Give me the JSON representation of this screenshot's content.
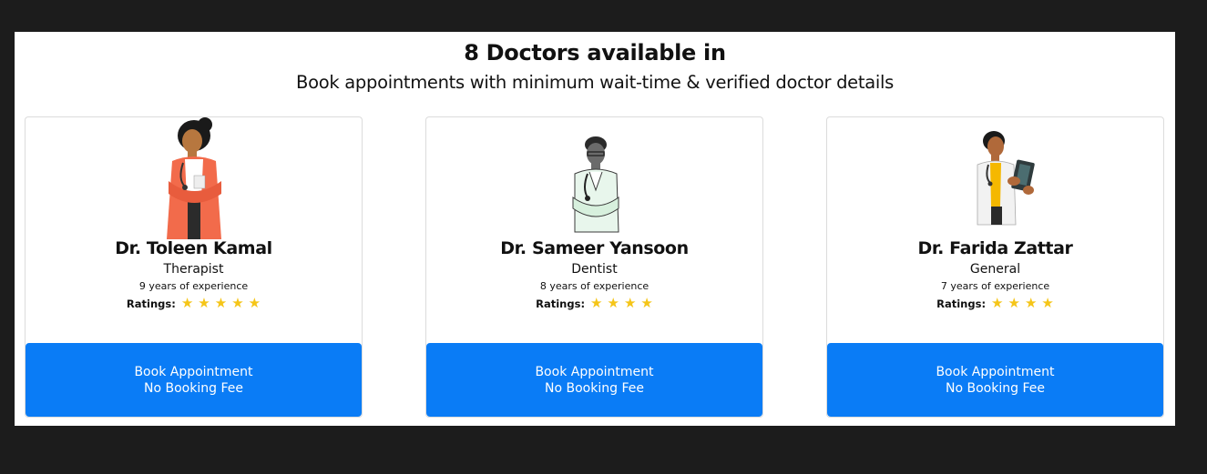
{
  "header": {
    "title": "8 Doctors  available in",
    "subtitle": "Book appointments with minimum wait-time & verified doctor details"
  },
  "doctors": [
    {
      "name": "Dr. Toleen Kamal",
      "specialty": "Therapist",
      "experience": "9 years of experience",
      "ratings_label": "Ratings:",
      "stars": 5,
      "button_line1": "Book Appointment",
      "button_line2": "No Booking Fee",
      "avatar_icon": "doctor-woman-orange-cardigan-icon"
    },
    {
      "name": "Dr. Sameer Yansoon",
      "specialty": "Dentist",
      "experience": "8 years of experience",
      "ratings_label": "Ratings:",
      "stars": 4,
      "button_line1": "Book Appointment",
      "button_line2": "No Booking Fee",
      "avatar_icon": "doctor-man-green-coat-icon"
    },
    {
      "name": "Dr. Farida Zattar",
      "specialty": "General",
      "experience": "7 years of experience",
      "ratings_label": "Ratings:",
      "stars": 4,
      "button_line1": "Book Appointment",
      "button_line2": "No Booking Fee",
      "avatar_icon": "doctor-woman-clipboard-icon"
    }
  ],
  "colors": {
    "page_background": "#1c1c1c",
    "panel_background": "#ffffff",
    "button": "#0a7cf6",
    "star": "#f5c518"
  }
}
